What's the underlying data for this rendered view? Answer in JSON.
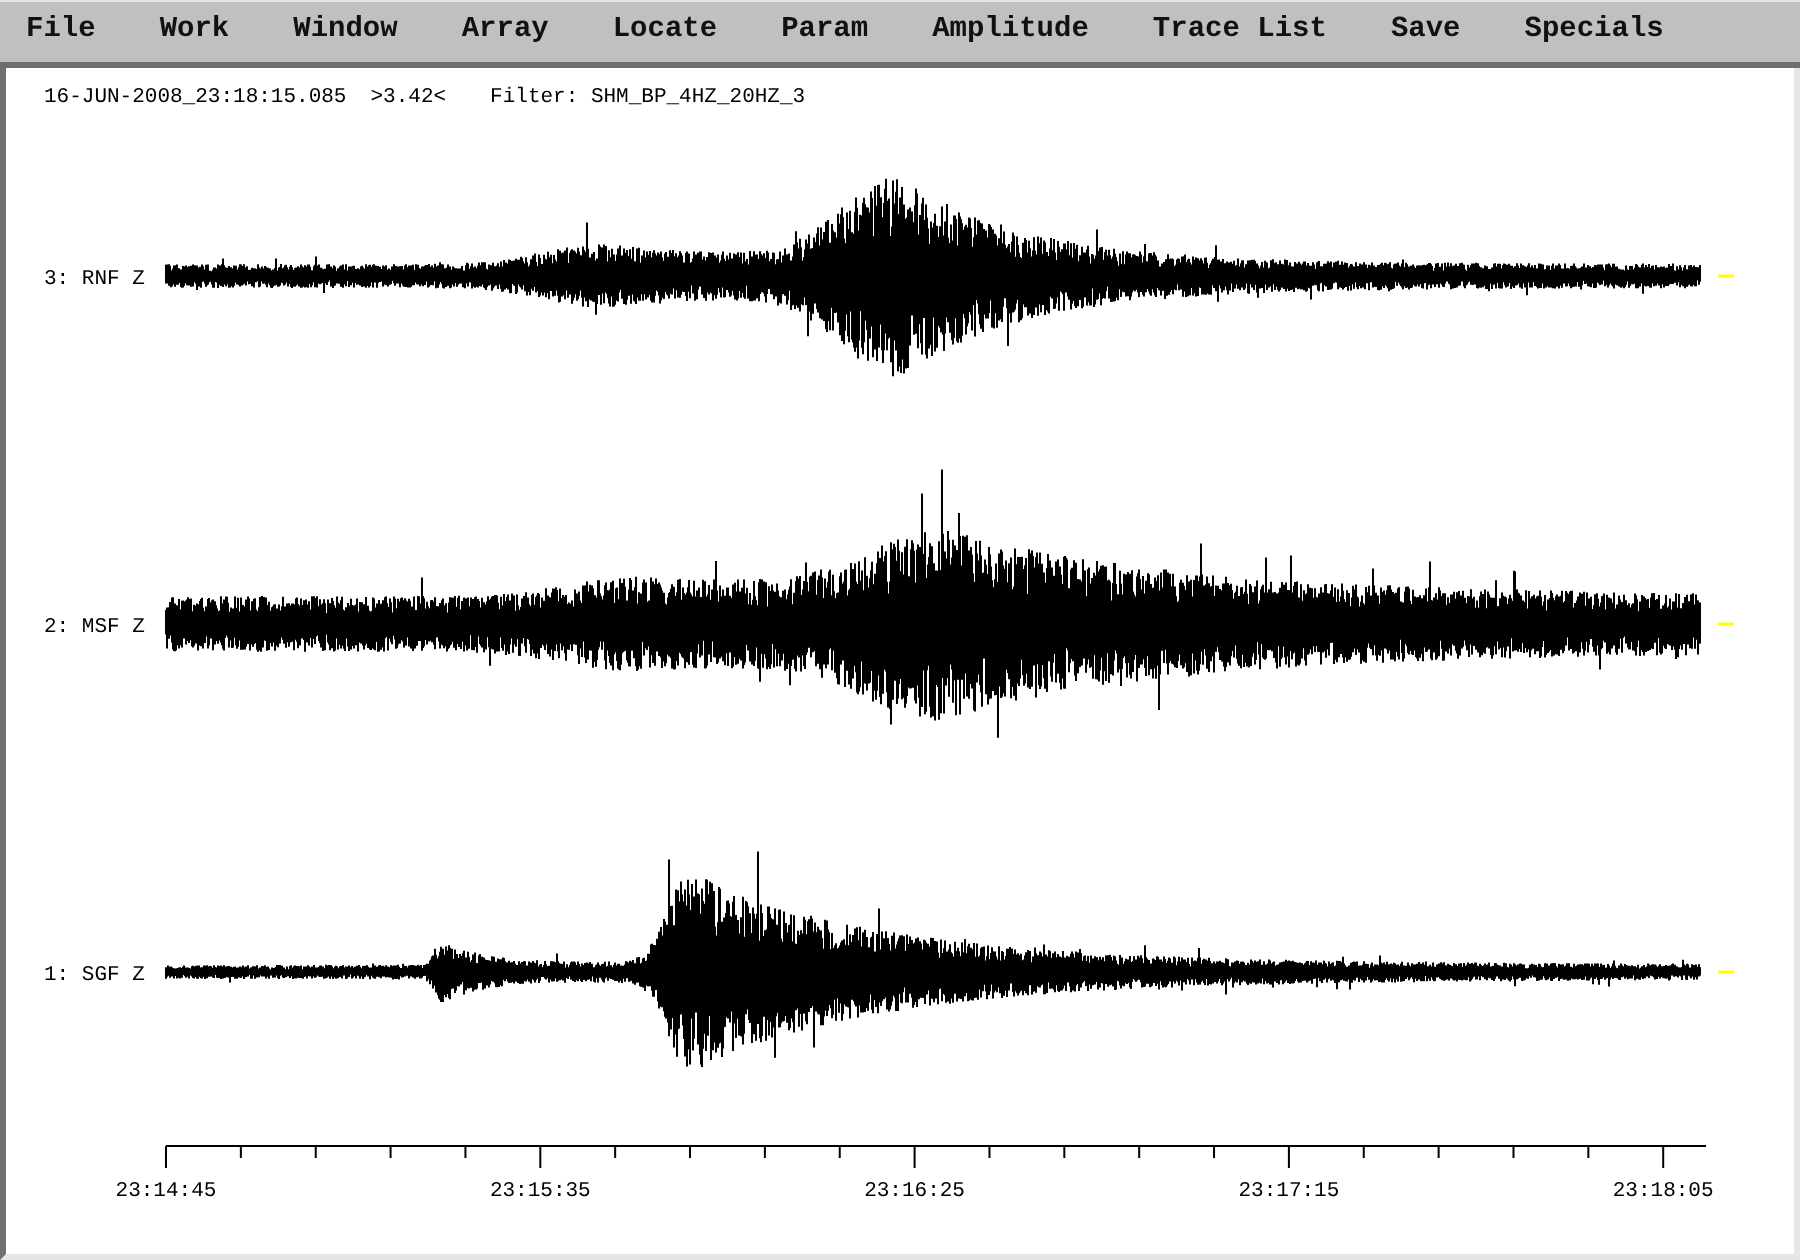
{
  "menu": [
    "File",
    "Work",
    "Window",
    "Array",
    "Locate",
    "Param",
    "Amplitude",
    "Trace List",
    "Save",
    "Specials"
  ],
  "info": {
    "timestamp": "16-JUN-2008_23:18:15.085",
    "value": ">3.42<",
    "filter": "Filter: SHM_BP_4HZ_20HZ_3"
  },
  "traces": [
    {
      "label": "3: RNF Z"
    },
    {
      "label": "2: MSF Z"
    },
    {
      "label": "1: SGF Z"
    }
  ],
  "time_axis": {
    "labels": [
      "23:14:45",
      "23:15:35",
      "23:16:25",
      "23:17:15",
      "23:18:05"
    ]
  }
}
